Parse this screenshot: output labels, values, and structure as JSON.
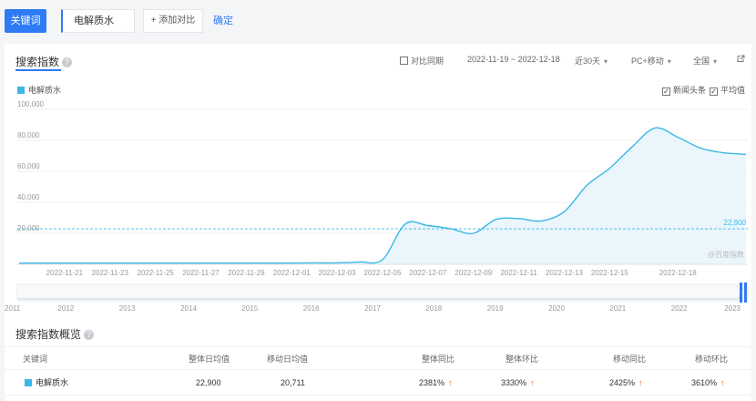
{
  "topbar": {
    "keyword_button": "关键词",
    "keyword_value": "电解质水",
    "add_compare": "+ 添加对比",
    "confirm": "确定"
  },
  "search_index": {
    "title": "搜索指数",
    "toolbar": {
      "compare_same_period": "对比同期",
      "date_range": "2022-11-19 ~ 2022-12-18",
      "period": "近30天",
      "device": "PC+移动",
      "region": "全国"
    },
    "legend_label": "电解质水",
    "opt_news": "新闻头条",
    "opt_average": "平均值",
    "watermark": "@百度指数",
    "average_label": "22,900",
    "colors": {
      "accent": "#2f7bf5",
      "series": "#3ab7e6",
      "fill": "#eaf6fc",
      "up_arrow": "#e8541e"
    }
  },
  "chart_data": {
    "type": "area",
    "title": "",
    "xlabel": "",
    "ylabel": "",
    "ylim": [
      0,
      100000
    ],
    "y_ticks": [
      "100,000",
      "80,000",
      "60,000",
      "40,000",
      "20,000"
    ],
    "x_tick_labels": [
      "2022-11-21",
      "2022-11-23",
      "2022-11-25",
      "2022-11-27",
      "2022-11-29",
      "2022-12-01",
      "2022-12-03",
      "2022-12-05",
      "2022-12-07",
      "2022-12-09",
      "2022-12-11",
      "2022-12-13",
      "2022-12-15",
      "2022-12-18"
    ],
    "x": [
      "2022-11-19",
      "2022-11-20",
      "2022-11-21",
      "2022-11-22",
      "2022-11-23",
      "2022-11-24",
      "2022-11-25",
      "2022-11-26",
      "2022-11-27",
      "2022-11-28",
      "2022-11-29",
      "2022-11-30",
      "2022-12-01",
      "2022-12-02",
      "2022-12-03",
      "2022-12-04",
      "2022-12-05",
      "2022-12-06",
      "2022-12-07",
      "2022-12-08",
      "2022-12-09",
      "2022-12-10",
      "2022-12-11",
      "2022-12-12",
      "2022-12-13",
      "2022-12-14",
      "2022-12-15",
      "2022-12-16",
      "2022-12-17",
      "2022-12-18"
    ],
    "series": [
      {
        "values": [
          800,
          800,
          800,
          800,
          800,
          800,
          800,
          800,
          800,
          800,
          800,
          800,
          800,
          900,
          900,
          1500,
          3000,
          26000,
          25000,
          23000,
          20000,
          29000,
          29500,
          28000,
          34000,
          51000,
          62000,
          76000,
          88000,
          82000,
          75000,
          72000,
          71000
        ]
      }
    ],
    "average": 22900,
    "grid": true
  },
  "timeline": {
    "years": [
      "2011",
      "2012",
      "2013",
      "2014",
      "2015",
      "2016",
      "2017",
      "2018",
      "2019",
      "2020",
      "2021",
      "2022",
      "2023"
    ]
  },
  "overview": {
    "title": "搜索指数概览",
    "columns": [
      "关键词",
      "整体日均值",
      "移动日均值",
      "整体同比",
      "整体环比",
      "移动同比",
      "移动环比"
    ],
    "rows": [
      {
        "keyword": "电解质水",
        "overall_avg": "22,900",
        "mobile_avg": "20,711",
        "overall_yoy": "2381%",
        "overall_mom": "3330%",
        "mobile_yoy": "2425%",
        "mobile_mom": "3610%"
      }
    ]
  }
}
